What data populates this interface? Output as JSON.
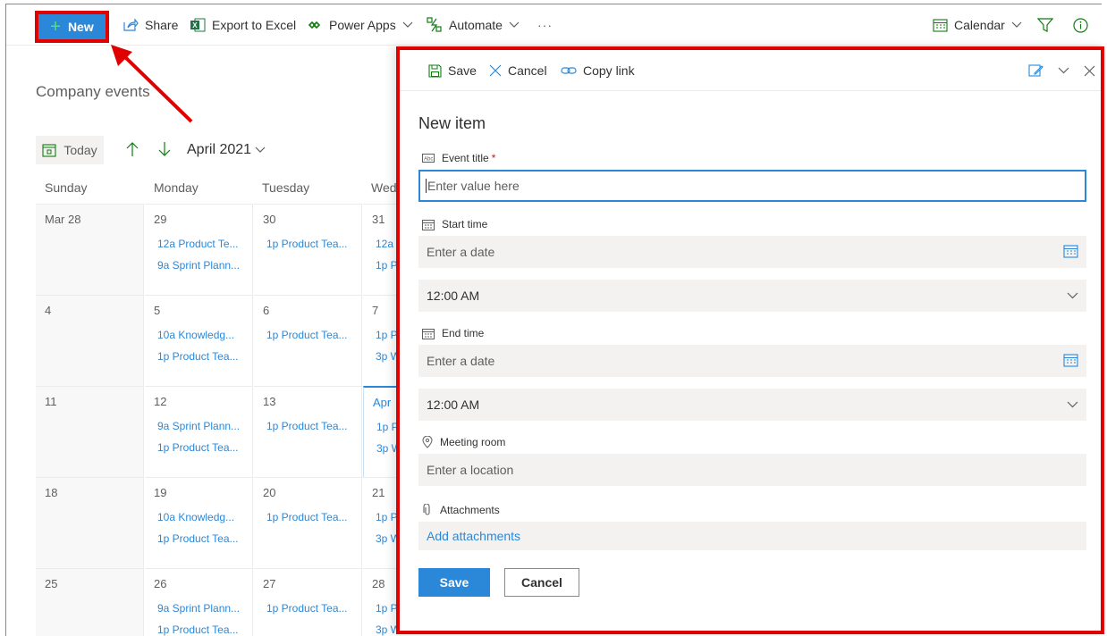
{
  "toolbar": {
    "new_label": "New",
    "share_label": "Share",
    "export_label": "Export to Excel",
    "powerapps_label": "Power Apps",
    "automate_label": "Automate",
    "more_label": "···",
    "view_label": "Calendar"
  },
  "list": {
    "title": "Company events"
  },
  "calendar": {
    "today_label": "Today",
    "month_label": "April 2021",
    "days": [
      "Sunday",
      "Monday",
      "Tuesday",
      "Wed"
    ],
    "weeks": [
      [
        {
          "day": "Mar 28",
          "events": []
        },
        {
          "day": "29",
          "events": [
            "12a Product Te...",
            "9a Sprint Plann..."
          ]
        },
        {
          "day": "30",
          "events": [
            "1p Product Tea..."
          ]
        },
        {
          "day": "31",
          "events": [
            "12a",
            "1p P"
          ]
        }
      ],
      [
        {
          "day": "4",
          "events": []
        },
        {
          "day": "5",
          "events": [
            "10a Knowledg...",
            "1p Product Tea..."
          ]
        },
        {
          "day": "6",
          "events": [
            "1p Product Tea..."
          ]
        },
        {
          "day": "7",
          "events": [
            "1p P",
            "3p W"
          ]
        }
      ],
      [
        {
          "day": "11",
          "events": []
        },
        {
          "day": "12",
          "events": [
            "9a Sprint Plann...",
            "1p Product Tea..."
          ]
        },
        {
          "day": "13",
          "events": [
            "1p Product Tea..."
          ]
        },
        {
          "day": "Apr",
          "events": [
            "1p P",
            "3p W"
          ]
        }
      ],
      [
        {
          "day": "18",
          "events": []
        },
        {
          "day": "19",
          "events": [
            "10a Knowledg...",
            "1p Product Tea..."
          ]
        },
        {
          "day": "20",
          "events": [
            "1p Product Tea..."
          ]
        },
        {
          "day": "21",
          "events": [
            "1p P",
            "3p W"
          ]
        }
      ],
      [
        {
          "day": "25",
          "events": []
        },
        {
          "day": "26",
          "events": [
            "9a Sprint Plann...",
            "1p Product Tea..."
          ]
        },
        {
          "day": "27",
          "events": [
            "1p Product Tea..."
          ]
        },
        {
          "day": "28",
          "events": [
            "1p P",
            "3p W"
          ]
        }
      ]
    ]
  },
  "panel": {
    "toolbar": {
      "save_label": "Save",
      "cancel_label": "Cancel",
      "copy_link_label": "Copy link"
    },
    "title": "New item",
    "fields": {
      "event_title": {
        "label": "Event title",
        "required_mark": "*",
        "placeholder": "Enter value here"
      },
      "start_time": {
        "label": "Start time",
        "date_placeholder": "Enter a date",
        "time_value": "12:00 AM"
      },
      "end_time": {
        "label": "End time",
        "date_placeholder": "Enter a date",
        "time_value": "12:00 AM"
      },
      "meeting_room": {
        "label": "Meeting room",
        "placeholder": "Enter a location"
      },
      "attachments": {
        "label": "Attachments",
        "link_label": "Add attachments"
      }
    },
    "save_button": "Save",
    "cancel_button": "Cancel"
  },
  "colors": {
    "accent": "#2b88d8",
    "highlight_border": "#e00000",
    "excel_green": "#217346",
    "powerapps_green": "#107c10"
  }
}
